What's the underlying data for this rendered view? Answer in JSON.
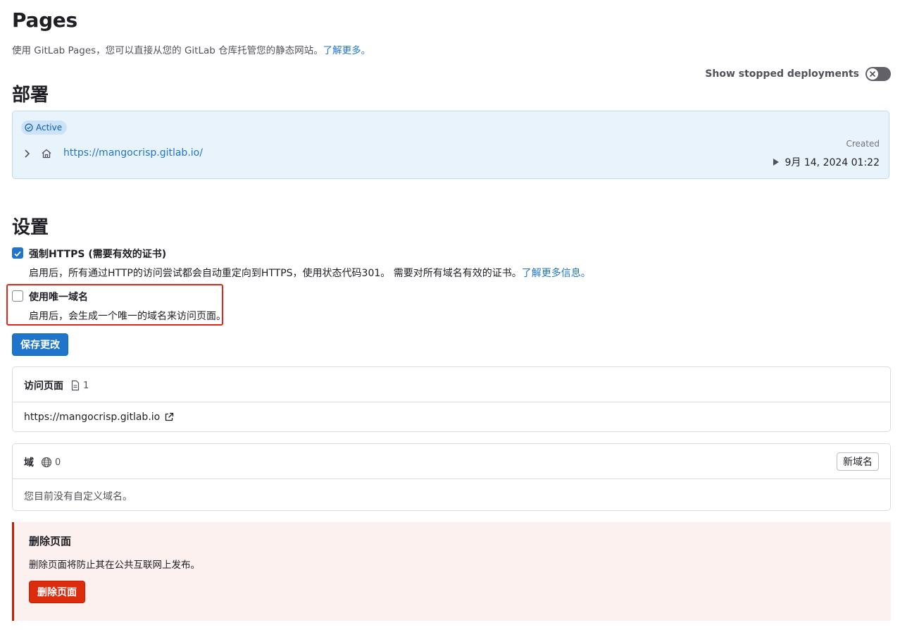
{
  "header": {
    "title": "Pages",
    "description": "使用 GitLab Pages，您可以直接从您的 GitLab 仓库托管您的静态网站。",
    "learn_more": "了解更多。"
  },
  "stopped_toggle": {
    "label": "Show stopped deployments",
    "enabled": false
  },
  "deployments": {
    "heading": "部署",
    "item": {
      "status": "Active",
      "url": "https://mangocrisp.gitlab.io/",
      "created_label": "Created",
      "created_date": "9月 14, 2024 01:22"
    }
  },
  "settings": {
    "heading": "设置",
    "force_https": {
      "label": "强制HTTPS (需要有效的证书)",
      "checked": true,
      "help": "启用后，所有通过HTTP的访问尝试都会自动重定向到HTTPS，使用状态代码301。 需要对所有域名有效的证书。",
      "help_link": "了解更多信息。"
    },
    "unique_domain": {
      "label": "使用唯一域名",
      "checked": false,
      "help": "启用后，会生成一个唯一的域名来访问页面。"
    },
    "save_button": "保存更改"
  },
  "access_pages": {
    "title": "访问页面",
    "count": "1",
    "url": "https://mangocrisp.gitlab.io"
  },
  "domains": {
    "title": "域",
    "count": "0",
    "new_button": "新域名",
    "empty_text": "您目前没有自定义域名。"
  },
  "danger_zone": {
    "title": "删除页面",
    "description": "删除页面将防止其在公共互联网上发布。",
    "button": "删除页面"
  },
  "colors": {
    "accent": "#1f75cb",
    "danger": "#dd2b0e",
    "highlight": "#e2261b",
    "deploy_bg": "#e9f3fc"
  }
}
